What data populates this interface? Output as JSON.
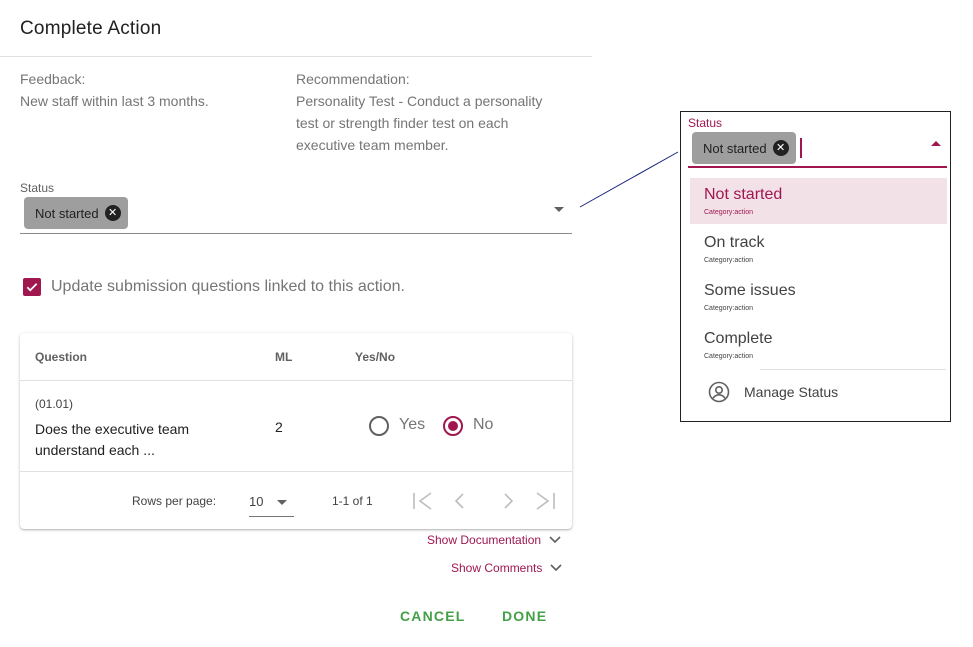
{
  "dialog": {
    "title": "Complete Action",
    "feedback_label": "Feedback:",
    "feedback_text": "New staff within last 3 months.",
    "recommendation_label": "Recommendation:",
    "recommendation_lines": [
      "Personality Test - Conduct a personality",
      "test or strength finder test on each",
      "executive team member."
    ],
    "status_label": "Status",
    "status_chip": "Not started",
    "checkbox_checked": true,
    "checkbox_label": "Update submission questions linked to this action."
  },
  "table": {
    "headers": [
      "Question",
      "ML",
      "Yes/No"
    ],
    "rows": [
      {
        "code": "(01.01)",
        "question_lines": [
          "Does the executive team",
          "understand each ..."
        ],
        "ml": "2",
        "yes_label": "Yes",
        "no_label": "No",
        "selected": "No"
      }
    ],
    "rows_per_page_label": "Rows per page:",
    "rows_per_page_value": "10",
    "range": "1-1 of 1"
  },
  "links": {
    "documentation": "Show Documentation",
    "comments": "Show Comments"
  },
  "actions": {
    "cancel": "CANCEL",
    "done": "DONE"
  },
  "popup": {
    "label": "Status",
    "chip": "Not started",
    "options": [
      {
        "label": "Not started",
        "category": "Category:action",
        "selected": true
      },
      {
        "label": "On track",
        "category": "Category:action",
        "selected": false
      },
      {
        "label": "Some issues",
        "category": "Category:action",
        "selected": false
      },
      {
        "label": "Complete",
        "category": "Category:action",
        "selected": false
      }
    ],
    "manage": "Manage Status"
  },
  "colors": {
    "accent": "#a0174f",
    "action_green": "#43a047",
    "chip_gray": "#9e9e9e"
  }
}
